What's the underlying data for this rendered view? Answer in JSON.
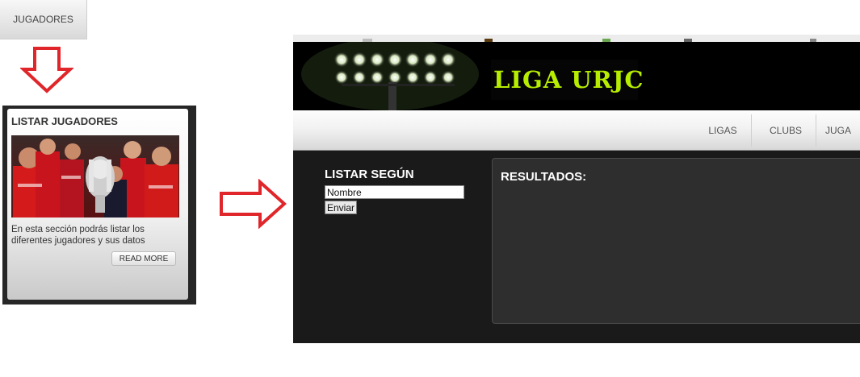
{
  "top_tab": {
    "label": "JUGADORES"
  },
  "card": {
    "title": "LISTAR JUGADORES",
    "description": "En esta sección podrás listar los diferentes jugadores y sus datos",
    "read_more": "READ MORE"
  },
  "site": {
    "logo": "LIGA URJC",
    "nav": [
      "LIGAS",
      "CLUBS",
      "JUGA"
    ]
  },
  "form": {
    "title": "LISTAR SEGÚN",
    "nombre_value": "Nombre",
    "submit_label": "Enviar"
  },
  "results": {
    "title": "RESULTADOS:"
  },
  "colors": {
    "arrow": "#e0262a",
    "logo": "#b7ee00",
    "page_bg": "#1a1a1a",
    "panel_bg": "#2e2e2e"
  },
  "icons": [
    "down-arrow-icon",
    "right-arrow-icon"
  ]
}
